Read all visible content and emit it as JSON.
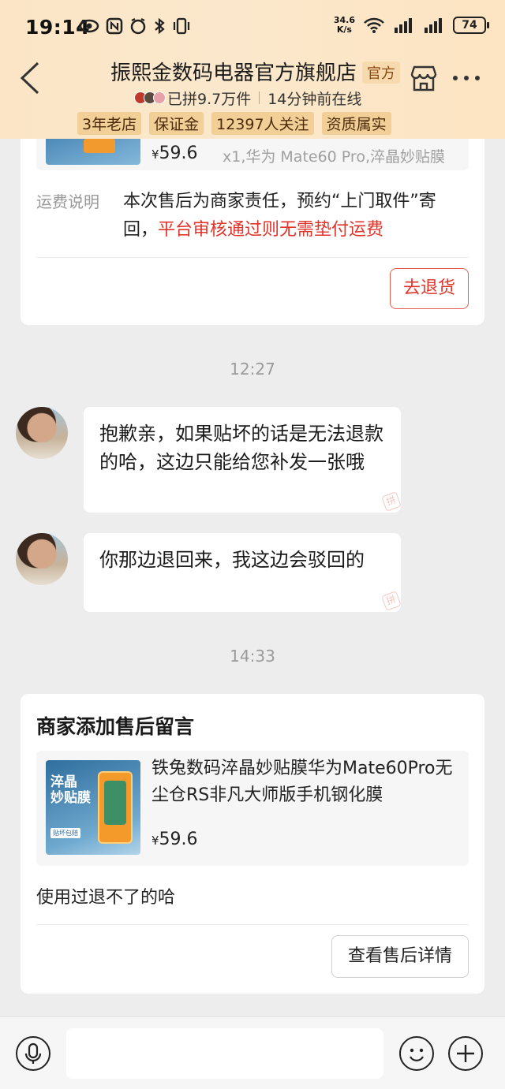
{
  "status_bar": {
    "time": "19:14",
    "speed_value": "34.6",
    "speed_unit": "K/s",
    "battery": "74"
  },
  "header": {
    "shop_name": "振熙金数码电器官方旗舰店",
    "official_label": "官方",
    "group_buy_count": "已拼9.7万件",
    "online_status": "14分钟前在线",
    "tags": [
      "3年老店",
      "保证金",
      "12397人关注",
      "资质属实"
    ]
  },
  "return_card": {
    "price_symbol": "¥",
    "price": "59.6",
    "spec": "x1,华为 Mate60 Pro,淬晶妙贴膜",
    "shipping_label": "运费说明",
    "shipping_text": "本次售后为商家责任，预约“上门取件”寄回，",
    "shipping_highlight": "平台审核通过则无需垫付运费",
    "return_button": "去退货"
  },
  "messages": [
    {
      "timestamp": "12:27"
    },
    {
      "text": "抱歉亲，如果贴坏的话是无法退款的哈，这边只能给您补发一张哦"
    },
    {
      "text": "你那边退回来，我这边会驳回的"
    },
    {
      "timestamp": "14:33"
    }
  ],
  "aftersale_card": {
    "title": "商家添加售后留言",
    "thumb_title": "淬晶\n妙贴膜",
    "product_name": "铁兔数码淬晶妙贴膜华为Mate60Pro无尘仓RS非凡大师版手机钢化膜",
    "price_symbol": "¥",
    "price": "59.6",
    "message": "使用过退不了的哈",
    "detail_button": "查看售后详情"
  },
  "bottom_bar": {
    "input_placeholder": ""
  },
  "colors": {
    "accent_red": "#e0352b",
    "header_bg": "#fbe5c6",
    "tag_bg": "#f3cf98",
    "page_bg": "#ededed"
  },
  "icons": [
    "back-icon",
    "store-icon",
    "more-icon",
    "voice-icon",
    "emoji-icon",
    "plus-icon"
  ]
}
